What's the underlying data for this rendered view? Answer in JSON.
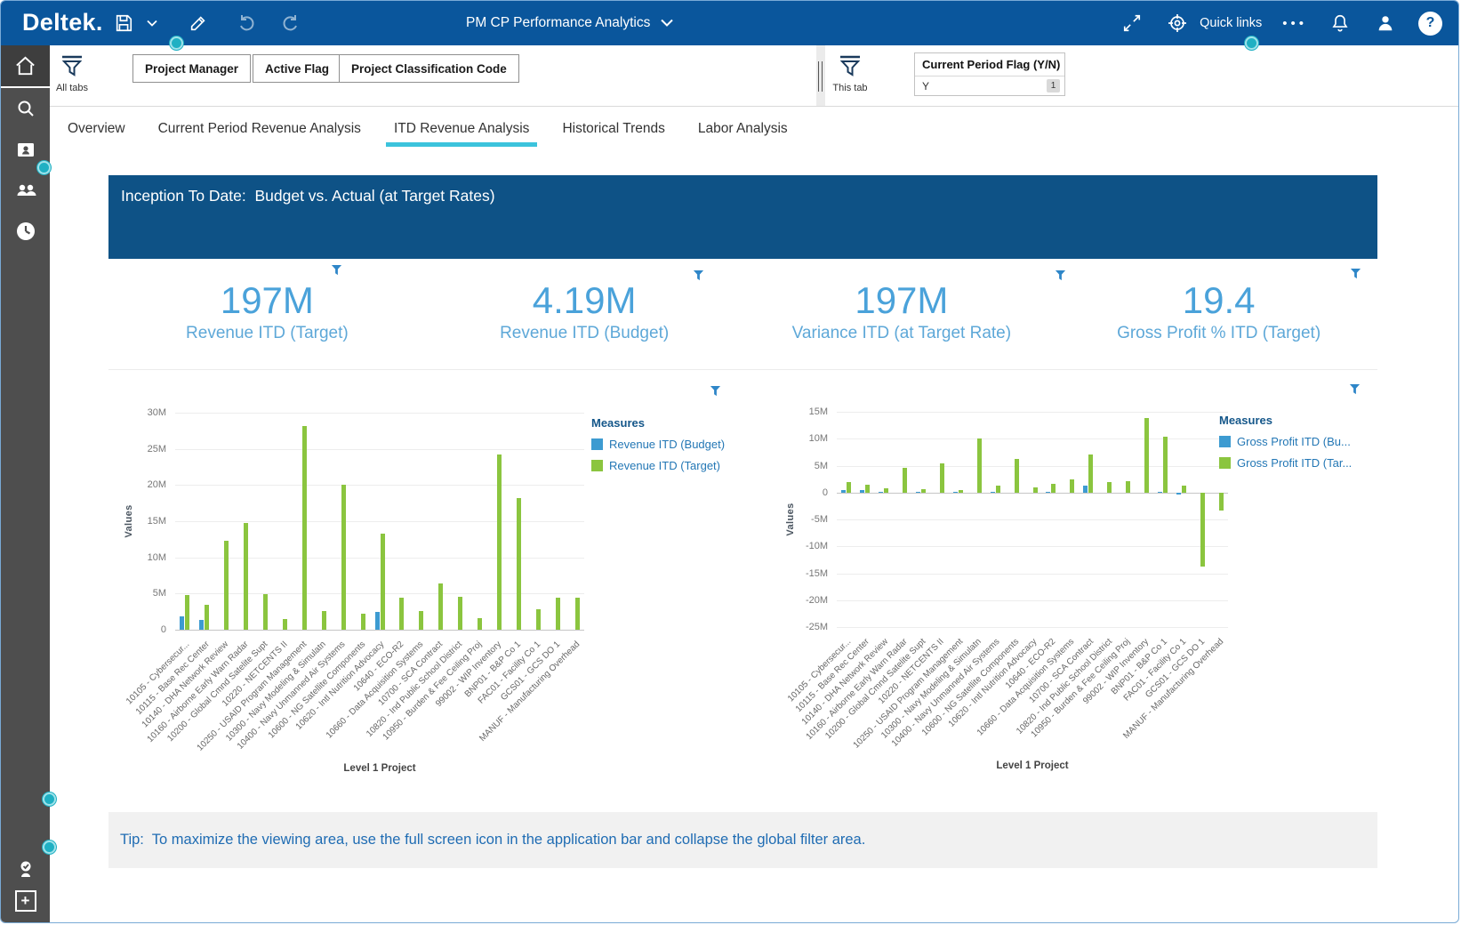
{
  "topbar": {
    "logo": "Deltek.",
    "title": "PM CP Performance Analytics",
    "quick_links": "Quick links"
  },
  "icons": {
    "ellipsis_glyph": "•••",
    "help_glyph": "?",
    "plus_glyph": "+"
  },
  "filters": {
    "all_tabs_label": "All tabs",
    "this_tab_label": "This tab",
    "buttons": [
      "Project Manager",
      "Active Flag",
      "Project Classification Code"
    ],
    "chip": {
      "title": "Current Period Flag (Y/N)",
      "value": "Y",
      "count": "1"
    }
  },
  "tabs": [
    {
      "label": "Overview"
    },
    {
      "label": "Current Period Revenue Analysis"
    },
    {
      "label": "ITD Revenue Analysis"
    },
    {
      "label": "Historical Trends"
    },
    {
      "label": "Labor Analysis"
    }
  ],
  "banner": {
    "title": "Inception To Date:  Budget vs. Actual (at Target Rates)"
  },
  "kpis": [
    {
      "value": "197M",
      "label": "Revenue ITD (Target)"
    },
    {
      "value": "4.19M",
      "label": "Revenue ITD (Budget)"
    },
    {
      "value": "197M",
      "label": "Variance ITD (at Target Rate)"
    },
    {
      "value": "19.4",
      "label": "Gross Profit % ITD (Target)"
    }
  ],
  "tip": {
    "text": "Tip:  To maximize the viewing area, use the full screen icon in the application bar and collapse the global filter area."
  },
  "chart_data": [
    {
      "type": "bar",
      "ylabel": "Values",
      "xlabel": "Level 1 Project",
      "legend_title": "Measures",
      "legend_position": "right",
      "grid": true,
      "ylim": [
        0,
        30
      ],
      "yticks": [
        {
          "v": 30,
          "label": "30M"
        },
        {
          "v": 25,
          "label": "25M"
        },
        {
          "v": 20,
          "label": "20M"
        },
        {
          "v": 15,
          "label": "15M"
        },
        {
          "v": 10,
          "label": "10M"
        },
        {
          "v": 5,
          "label": "5M"
        },
        {
          "v": 0,
          "label": "0"
        }
      ],
      "categories": [
        "10105 - Cybersecur...",
        "10115 - Base Rec Center",
        "10140 - DHA Network Review",
        "10160 - Airborne Early Warn Radar",
        "10200 - Global Cmnd Satelite Supt",
        "10220 - NETCENTS II",
        "10250 - USAID Program Management",
        "10300 - Navy Modeling & Simulatn",
        "10400 - Navy Unmanned Air Systems",
        "10600 - NG Satellite Components",
        "10620 - Intl Nutrition Advocacy",
        "10640 - ECO-R2",
        "10660 - Data Acquisition Systems",
        "10700 - SCA Contract",
        "10820 - Ind Public School District",
        "10950 - Burden & Fee Ceiling Proj",
        "99002 - WIP Inventory",
        "BNP01 - B&P Co 1",
        "FAC01 - Facility Co 1",
        "GCS01 - GCS DO 1",
        "MANUF - Manufacturing Overhead"
      ],
      "series": [
        {
          "name": "Revenue ITD (Budget)",
          "color": "#3d9bd1",
          "values": [
            1.9,
            1.3,
            0,
            0,
            0,
            0,
            0,
            0,
            0,
            0,
            2.5,
            0,
            0,
            0,
            0,
            0,
            0,
            0,
            0,
            0,
            0
          ]
        },
        {
          "name": "Revenue ITD (Target)",
          "color": "#8bc53f",
          "values": [
            4.8,
            3.4,
            12.3,
            14.8,
            4.9,
            1.5,
            28.2,
            2.6,
            20.1,
            2.2,
            13.3,
            4.4,
            2.6,
            6.4,
            4.6,
            1.6,
            24.2,
            18.2,
            2.8,
            4.4,
            4.4
          ]
        }
      ]
    },
    {
      "type": "bar",
      "ylabel": "Values",
      "xlabel": "Level 1 Project",
      "legend_title": "Measures",
      "legend_position": "right",
      "grid": true,
      "ylim": [
        -25,
        15
      ],
      "yticks": [
        {
          "v": 15,
          "label": "15M"
        },
        {
          "v": 10,
          "label": "10M"
        },
        {
          "v": 5,
          "label": "5M"
        },
        {
          "v": 0,
          "label": "0"
        },
        {
          "v": -5,
          "label": "-5M"
        },
        {
          "v": -10,
          "label": "-10M"
        },
        {
          "v": -15,
          "label": "-15M"
        },
        {
          "v": -20,
          "label": "-20M"
        },
        {
          "v": -25,
          "label": "-25M"
        }
      ],
      "categories": [
        "10105 - Cybersecur...",
        "10115 - Base Rec Center",
        "10140 - DHA Network Review",
        "10160 - Airborne Early Warn Radar",
        "10200 - Global Cmnd Satelite Supt",
        "10220 - NETCENTS II",
        "10250 - USAID Program Management",
        "10300 - Navy Modeling & Simulatn",
        "10400 - Navy Unmanned Air Systems",
        "10600 - NG Satellite Components",
        "10620 - Intl Nutrition Advocacy",
        "10640 - ECO-R2",
        "10660 - Data Acquisition Systems",
        "10700 - SCA Contract",
        "10820 - Ind Public School District",
        "10950 - Burden & Fee Ceiling Proj",
        "99002 - WIP Inventory",
        "BNP01 - B&P Co 1",
        "FAC01 - Facility Co 1",
        "GCS01 - GCS DO 1",
        "MANUF - Manufacturing Overhead"
      ],
      "series": [
        {
          "name": "Gross Profit ITD (Bu...",
          "color": "#3d9bd1",
          "values": [
            0.5,
            0.4,
            0.1,
            0,
            0.1,
            0,
            0.2,
            0,
            0.1,
            0,
            0,
            0.1,
            0,
            1.3,
            0,
            0,
            0,
            0.1,
            -0.3,
            0,
            0
          ]
        },
        {
          "name": "Gross Profit ITD (Tar...",
          "color": "#8bc53f",
          "values": [
            2.0,
            1.5,
            0.8,
            4.6,
            0.6,
            5.4,
            0.5,
            10.1,
            1.2,
            6.3,
            1.0,
            1.6,
            2.4,
            7.1,
            2.0,
            2.1,
            13.8,
            10.3,
            1.2,
            -13.7,
            -3.4
          ]
        }
      ]
    }
  ]
}
